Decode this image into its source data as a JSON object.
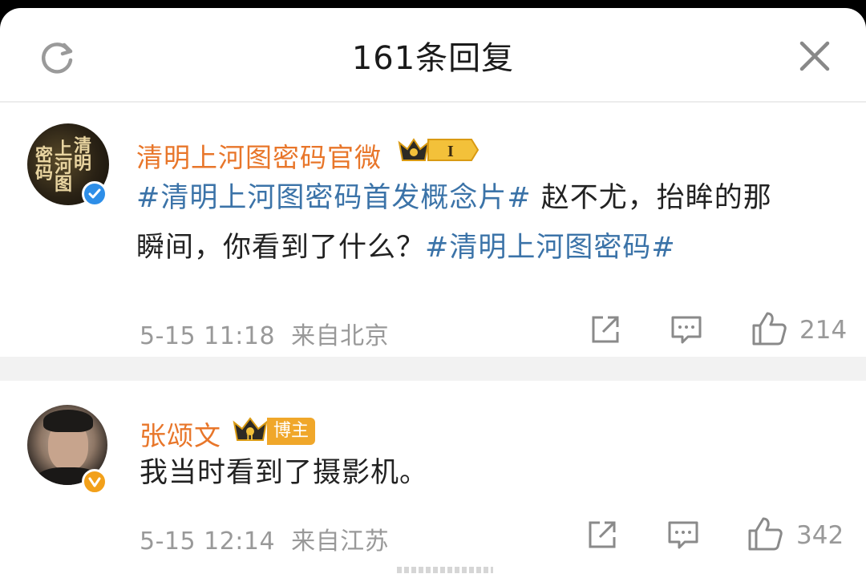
{
  "header": {
    "title": "161条回复"
  },
  "post": {
    "username": "清明上河图密码官微",
    "rank_badge": "I",
    "avatar_text": [
      "清",
      "明",
      "上",
      "河",
      "图",
      "密",
      "码"
    ],
    "text_topic_1": "#清明上河图密码首发概念片#",
    "text_line1_rest": " 赵不尤，抬眸的那",
    "text_line2": "瞬间，你看到了什么？",
    "text_topic_2": "#清明上河图密码#",
    "time": "5-15 11:18",
    "location": "来自北京",
    "likes": "214"
  },
  "reply": {
    "username": "张颂文",
    "tag": "博主",
    "text": "我当时看到了摄影机。",
    "time": "5-15 12:14",
    "location": "来自江苏",
    "likes": "342"
  },
  "colors": {
    "username": "#e8762a",
    "topic": "#3b73a8",
    "meta": "#999999",
    "verified_blue": "#2d8ee8",
    "verified_gold": "#f2a01a"
  },
  "icons": {
    "refresh": "refresh-icon",
    "close": "close-icon",
    "share": "share-icon",
    "comment": "comment-icon",
    "like": "thumbs-up-icon"
  }
}
